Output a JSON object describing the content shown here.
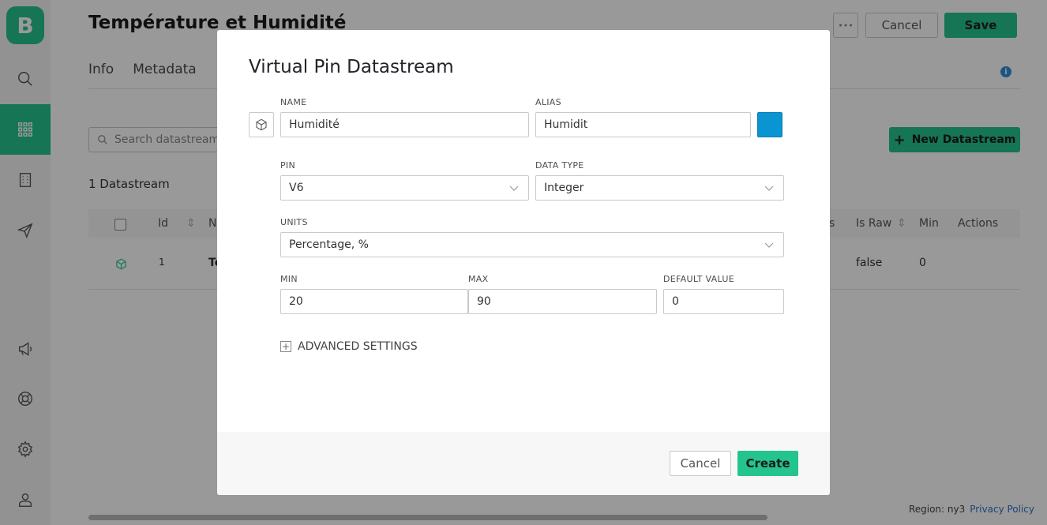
{
  "app": {
    "logo_letter": "B",
    "accent_color": "#23c48e",
    "page_title": "Température et Humidité"
  },
  "sidebar": {
    "items": [
      {
        "icon": "search-icon"
      },
      {
        "icon": "grid-icon",
        "active": true
      },
      {
        "icon": "building-icon"
      },
      {
        "icon": "send-icon"
      },
      {
        "icon": "megaphone-icon"
      },
      {
        "icon": "lifebuoy-icon"
      },
      {
        "icon": "gear-icon"
      },
      {
        "icon": "user-icon"
      }
    ]
  },
  "header": {
    "more_label": "•••",
    "cancel_label": "Cancel",
    "save_label": "Save",
    "info_label": "i"
  },
  "tabs": [
    {
      "label": "Info"
    },
    {
      "label": "Metadata"
    }
  ],
  "toolbar": {
    "search_placeholder": "Search datastream",
    "new_datastream_label": "New Datastream"
  },
  "table": {
    "count_label": "1 Datastream",
    "headers": {
      "id": "Id",
      "name": "N",
      "units_partial": "s",
      "is_raw": "Is Raw",
      "min": "Min",
      "actions": "Actions"
    },
    "rows": [
      {
        "id": "1",
        "name_partial": "Te",
        "is_raw": "false",
        "min": "0"
      }
    ]
  },
  "footer": {
    "region": "Region: ny3",
    "privacy": "Privacy Policy"
  },
  "modal": {
    "title": "Virtual Pin Datastream",
    "name_label": "NAME",
    "name_value": "Humidité",
    "alias_label": "ALIAS",
    "alias_value": "Humidit",
    "color": "#0a94d1",
    "pin_label": "PIN",
    "pin_value": "V6",
    "data_type_label": "DATA TYPE",
    "data_type_value": "Integer",
    "units_label": "UNITS",
    "units_value": "Percentage, %",
    "min_label": "MIN",
    "min_value": "20",
    "max_label": "MAX",
    "max_value": "90",
    "default_label": "DEFAULT VALUE",
    "default_value": "0",
    "advanced_label": "ADVANCED SETTINGS",
    "cancel_label": "Cancel",
    "create_label": "Create"
  }
}
